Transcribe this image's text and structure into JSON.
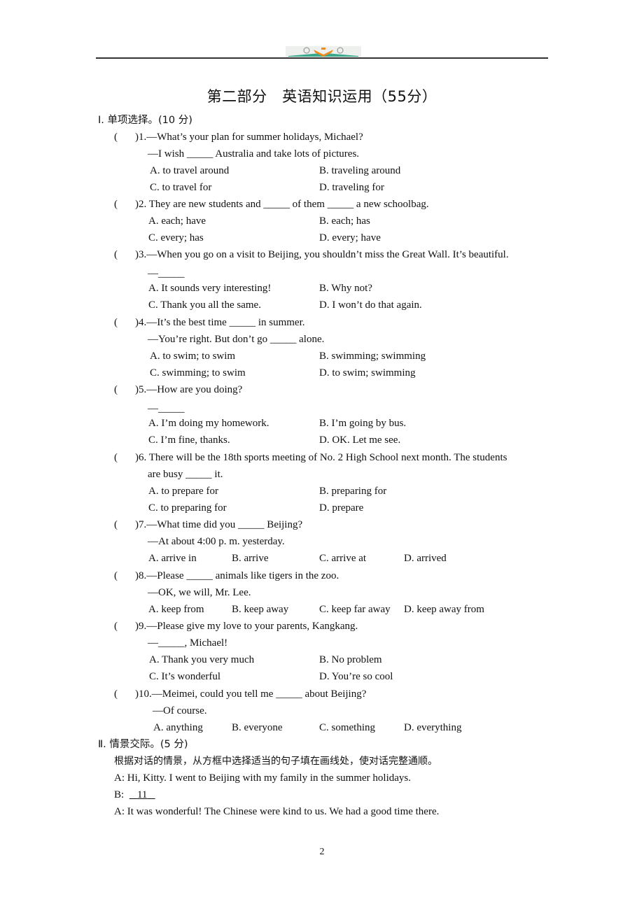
{
  "header": {
    "logo": "book-emblem-logo"
  },
  "title": "第二部分　英语知识运用（55分）",
  "section1": {
    "heading": "Ⅰ. 单项选择。(10 分)",
    "questions": [
      {
        "num": ")1.",
        "stem": "—What’s your plan for summer holidays, Michael?",
        "stem2": "—I wish _____ Australia and take lots of pictures.",
        "options": [
          "A. to travel around",
          "B. traveling around",
          "C. to travel for",
          "D. traveling for"
        ]
      },
      {
        "num": ")2.",
        "stem": " They are new students and _____ of them _____ a new schoolbag.",
        "options": [
          "A. each; have",
          "B. each; has",
          "C. every; has",
          "D. every; have"
        ]
      },
      {
        "num": ")3.",
        "stem": "—When you go on a visit to Beijing, you shouldn’t miss the Great Wall. It’s beautiful.",
        "stem2": "—_____",
        "options": [
          "A. It sounds very interesting!",
          "B. Why not?",
          "C. Thank you all the same.",
          "D. I won’t do that again."
        ]
      },
      {
        "num": ")4.",
        "stem": "—It’s the best time _____ in summer.",
        "stem2": "—You’re right. But don’t go _____ alone.",
        "options": [
          "A. to swim; to swim",
          "B. swimming; swimming",
          "C. swimming; to swim",
          "D. to swim; swimming"
        ]
      },
      {
        "num": ")5.",
        "stem": "—How are you doing?",
        "stem2": "—_____",
        "options": [
          "A. I’m doing my homework.",
          "B. I’m going by bus.",
          "C. I’m fine, thanks.",
          "D. OK. Let me see."
        ]
      },
      {
        "num": ")6.",
        "stem": " There will be the 18th sports meeting of No. 2 High School next month. The students",
        "stem2": "are busy _____ it.",
        "options": [
          "A. to prepare for",
          "B. preparing for",
          "C. to preparing for",
          "D. prepare"
        ]
      },
      {
        "num": ")7.",
        "stem": "—What time did you _____ Beijing?",
        "stem2": "—At about 4:00 p. m. yesterday.",
        "options": [
          "A. arrive in",
          "B. arrive",
          "C. arrive at",
          "D. arrived"
        ]
      },
      {
        "num": ")8.",
        "stem": "—Please _____ animals like tigers in the zoo.",
        "stem2": "—OK, we will, Mr. Lee.",
        "options": [
          "A. keep from",
          "B. keep away",
          "C. keep far away",
          "D. keep away from"
        ]
      },
      {
        "num": ")9.",
        "stem": "—Please give my love to your parents, Kangkang.",
        "stem2": "—_____, Michael!",
        "options": [
          "A. Thank you very much",
          "B. No problem",
          "C. It’s wonderful",
          "D. You’re so cool"
        ]
      },
      {
        "num": ")10.",
        "stem": "—Meimei, could you tell me _____ about Beijing?",
        "stem2": "—Of course.",
        "options": [
          "A. anything",
          "B. everyone",
          "C. something",
          "D. everything"
        ]
      }
    ]
  },
  "section2": {
    "heading": "Ⅱ. 情景交际。(5 分)",
    "instruction": "根据对话的情景，从方框中选择适当的句子填在画线处，使对话完整通顺。",
    "dialogue": [
      {
        "speaker": "A:",
        "text": " Hi, Kitty. I went to Beijing with my family in the summer holidays."
      },
      {
        "speaker": "B:",
        "text": "11"
      },
      {
        "speaker": "A:",
        "text": " It was wonderful! The Chinese were kind to us. We had a good time there."
      }
    ]
  },
  "page_number": "2"
}
